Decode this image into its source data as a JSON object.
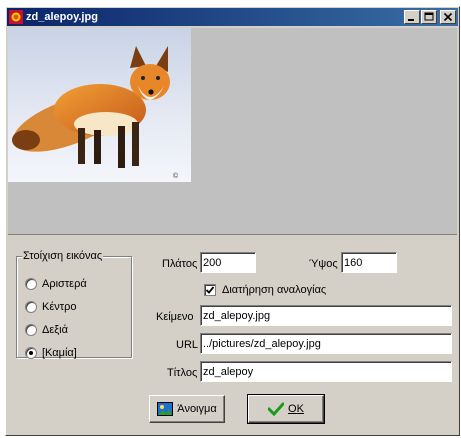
{
  "window": {
    "title": "zd_alepoy.jpg"
  },
  "align": {
    "legend": "Στοίχιση εικόνας",
    "options": [
      "Αριστερά",
      "Κέντρο",
      "Δεξιά",
      "[Καμία]"
    ],
    "selected_index": 3
  },
  "width": {
    "label": "Πλάτος",
    "value": "200"
  },
  "height": {
    "label": "Ύψος",
    "value": "160"
  },
  "keep_ratio": {
    "label": "Διατήρηση αναλογίας",
    "checked": true
  },
  "text": {
    "label": "Κείμενο",
    "value": "zd_alepoy.jpg"
  },
  "url": {
    "label": "URL",
    "value": "../pictures/zd_alepoy.jpg"
  },
  "tooltip": {
    "label": "Τίτλος",
    "value": "zd_alepoy"
  },
  "buttons": {
    "open": "Άνοιγμα",
    "ok": "OK"
  },
  "colors": {
    "titlebar_start": "#0a246a",
    "titlebar_end": "#3a6ea5",
    "dialog_bg": "#d4d0c8",
    "preview_bg": "#c0c0c0"
  },
  "icons": {
    "app": "fox-app-icon",
    "open": "picture-icon",
    "ok": "green-checkmark-icon"
  }
}
